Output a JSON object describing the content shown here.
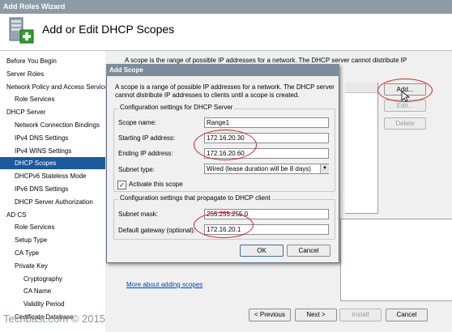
{
  "window": {
    "title": "Add Roles Wizard"
  },
  "header": {
    "title": "Add or Edit DHCP Scopes",
    "icon": "server-roles-add-icon"
  },
  "nav": {
    "items": [
      {
        "label": "Before You Begin",
        "indent": 0,
        "selected": false
      },
      {
        "label": "Server Roles",
        "indent": 0,
        "selected": false
      },
      {
        "label": "Network Policy and Access Services",
        "indent": 0,
        "selected": false
      },
      {
        "label": "Role Services",
        "indent": 1,
        "selected": false
      },
      {
        "label": "DHCP Server",
        "indent": 0,
        "selected": false
      },
      {
        "label": "Network Connection Bindings",
        "indent": 1,
        "selected": false
      },
      {
        "label": "IPv4 DNS Settings",
        "indent": 1,
        "selected": false
      },
      {
        "label": "IPv4 WINS Settings",
        "indent": 1,
        "selected": false
      },
      {
        "label": "DHCP Scopes",
        "indent": 1,
        "selected": true
      },
      {
        "label": "DHCPv6 Stateless Mode",
        "indent": 1,
        "selected": false
      },
      {
        "label": "IPv6 DNS Settings",
        "indent": 1,
        "selected": false
      },
      {
        "label": "DHCP Server Authorization",
        "indent": 1,
        "selected": false
      },
      {
        "label": "AD CS",
        "indent": 0,
        "selected": false
      },
      {
        "label": "Role Services",
        "indent": 1,
        "selected": false
      },
      {
        "label": "Setup Type",
        "indent": 1,
        "selected": false
      },
      {
        "label": "CA Type",
        "indent": 1,
        "selected": false
      },
      {
        "label": "Private Key",
        "indent": 1,
        "selected": false
      },
      {
        "label": "Cryptography",
        "indent": 2,
        "selected": false
      },
      {
        "label": "CA Name",
        "indent": 2,
        "selected": false
      },
      {
        "label": "Validity Period",
        "indent": 2,
        "selected": false
      },
      {
        "label": "Certificate Database",
        "indent": 1,
        "selected": false
      }
    ]
  },
  "main": {
    "description_line1": "A scope is the range of possible IP addresses for a network. The DHCP server cannot distribute IP",
    "description_line2": "",
    "add_label": "Add...",
    "edit_label": "Edit...",
    "delete_label": "Delete",
    "more_link": "More about adding scopes"
  },
  "footer": {
    "previous_label": "< Previous",
    "next_label": "Next >",
    "install_label": "Install",
    "cancel_label": "Cancel"
  },
  "dialog": {
    "title": "Add Scope",
    "description_line1": "A scope is a range of possible IP addresses for a network. The DHCP server",
    "description_line2": "cannot distribute IP addresses to clients until a scope is created.",
    "group1_title": "Configuration settings for DHCP Server",
    "scope_name_label": "Scope name:",
    "scope_name_value": "Range1",
    "start_ip_label": "Starting IP address:",
    "start_ip_value": "172.16.20.30",
    "end_ip_label": "Ending IP address:",
    "end_ip_value": "172.16.20.60",
    "subnet_type_label": "Subnet type:",
    "subnet_type_value": "Wired (lease duration will be 8 days)",
    "activate_label": "Activate this scope",
    "activate_checked": true,
    "group2_title": "Configuration settings that propagate to DHCP client",
    "subnet_mask_label": "Subnet mask:",
    "subnet_mask_value": "255.255.255.0",
    "gateway_label": "Default gateway (optional):",
    "gateway_value": "172.16.20.1",
    "ok_label": "OK",
    "cancel_label": "Cancel"
  },
  "watermark": "Techbast.com © 2015",
  "colors": {
    "selection": "#1c5a9c",
    "highlight_ellipse": "#d2232a",
    "link": "#0645ad"
  }
}
